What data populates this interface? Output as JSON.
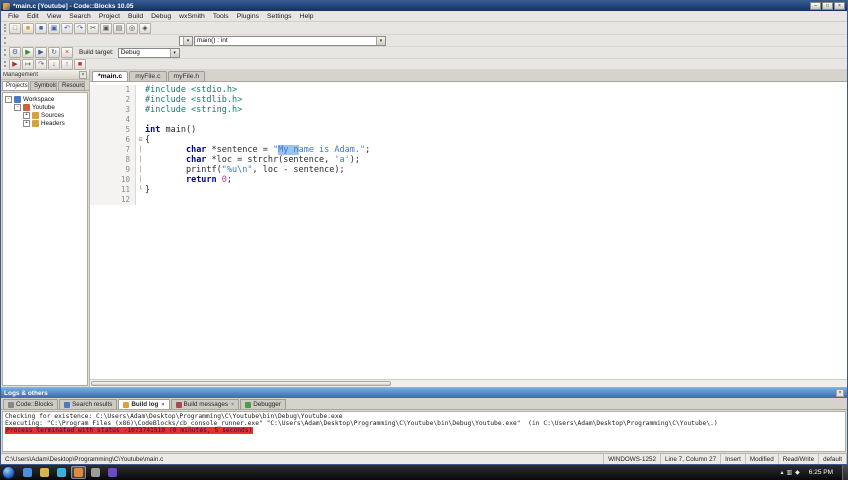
{
  "window": {
    "title": "*main.c [Youtube] - Code::Blocks 10.05",
    "buttons": [
      {
        "name": "minimize-button",
        "glyph": "–"
      },
      {
        "name": "maximize-button",
        "glyph": "□"
      },
      {
        "name": "close-button",
        "glyph": "×"
      }
    ]
  },
  "menu": {
    "items": [
      "File",
      "Edit",
      "View",
      "Search",
      "Project",
      "Build",
      "Debug",
      "wxSmith",
      "Tools",
      "Plugins",
      "Settings",
      "Help"
    ]
  },
  "toolbar": {
    "main_icons": [
      {
        "name": "new-file-icon",
        "glyph": "□",
        "color": "#6a6a6a"
      },
      {
        "name": "open-file-icon",
        "glyph": "■",
        "color": "#d8a23a"
      },
      {
        "name": "save-file-icon",
        "glyph": "■",
        "color": "#3a62b8"
      },
      {
        "name": "save-all-files-icon",
        "glyph": "▣",
        "color": "#3a62b8"
      },
      {
        "name": "undo-icon",
        "glyph": "↶",
        "color": "#2a62c0"
      },
      {
        "name": "redo-icon",
        "glyph": "↷",
        "color": "#2a62c0"
      },
      {
        "name": "cut-icon",
        "glyph": "✂",
        "color": "#555555"
      },
      {
        "name": "copy-icon",
        "glyph": "▣",
        "color": "#555555"
      },
      {
        "name": "paste-icon",
        "glyph": "▤",
        "color": "#555555"
      },
      {
        "name": "find-icon",
        "glyph": "◎",
        "color": "#444444"
      },
      {
        "name": "replace-icon",
        "glyph": "◈",
        "color": "#444444"
      }
    ],
    "symbol_scope_value": "",
    "symbol_function_value": "main() : int",
    "build_icons": [
      {
        "name": "compile-icon",
        "glyph": "⚙",
        "color": "#3a5a9c"
      },
      {
        "name": "run-icon",
        "glyph": "▶",
        "color": "#2e8b2e"
      },
      {
        "name": "build-and-run-icon",
        "glyph": "▶",
        "color": "#3a5a9c"
      },
      {
        "name": "rebuild-icon",
        "glyph": "↻",
        "color": "#3a5a9c"
      },
      {
        "name": "abort-build-icon",
        "glyph": "×",
        "color": "#c03030"
      }
    ],
    "build_target_label": "Build target:",
    "build_target_value": "Debug",
    "debug_icons": [
      {
        "name": "debug-continue-icon",
        "glyph": "▶",
        "color": "#a03030"
      },
      {
        "name": "run-to-cursor-icon",
        "glyph": "↦",
        "color": "#555555"
      },
      {
        "name": "next-line-icon",
        "glyph": "↷",
        "color": "#555555"
      },
      {
        "name": "step-into-icon",
        "glyph": "↓",
        "color": "#555555"
      },
      {
        "name": "step-out-icon",
        "glyph": "↑",
        "color": "#555555"
      },
      {
        "name": "debug-stop-icon",
        "glyph": "■",
        "color": "#c03030"
      }
    ]
  },
  "management": {
    "title": "Management",
    "tabs": [
      {
        "label": "Projects",
        "active": true
      },
      {
        "label": "Symbols",
        "active": false
      },
      {
        "label": "Resources",
        "active": false
      }
    ],
    "tree": [
      {
        "name": "tree-item-workspace",
        "label": "Workspace",
        "depth": 0,
        "expander": "-",
        "icon": "workspace-icon",
        "icon_color": "#4a7ac8"
      },
      {
        "name": "tree-item-youtube",
        "label": "Youtube",
        "depth": 1,
        "expander": "-",
        "icon": "project-icon",
        "icon_color": "#c8643a"
      },
      {
        "name": "tree-item-sources",
        "label": "Sources",
        "depth": 2,
        "expander": "+",
        "icon": "folder-icon",
        "icon_color": "#d8a23a"
      },
      {
        "name": "tree-item-headers",
        "label": "Headers",
        "depth": 2,
        "expander": "+",
        "icon": "folder-icon",
        "icon_color": "#d8a23a"
      }
    ]
  },
  "editor": {
    "tabs": [
      {
        "label": "*main.c",
        "active": true
      },
      {
        "label": "myFile.c",
        "active": false
      },
      {
        "label": "myFile.h",
        "active": false
      }
    ],
    "lines": [
      {
        "num": "1",
        "tokens": [
          {
            "t": "#include <stdio.h>",
            "c": "pre"
          }
        ]
      },
      {
        "num": "2",
        "tokens": [
          {
            "t": "#include <stdlib.h>",
            "c": "pre"
          }
        ]
      },
      {
        "num": "3",
        "tokens": [
          {
            "t": "#include <string.h>",
            "c": "pre"
          }
        ]
      },
      {
        "num": "4",
        "tokens": []
      },
      {
        "num": "5",
        "tokens": [
          {
            "t": "int",
            "c": "kw"
          },
          {
            "t": " main()",
            "c": "pln"
          }
        ]
      },
      {
        "num": "6",
        "fold": "start",
        "tokens": [
          {
            "t": "{",
            "c": "pln"
          }
        ]
      },
      {
        "num": "7",
        "fold": "mid",
        "tokens": [
          {
            "t": "        ",
            "c": "pln"
          },
          {
            "t": "char",
            "c": "kw"
          },
          {
            "t": " *sentence = ",
            "c": "pln"
          },
          {
            "t": "\"",
            "c": "str"
          },
          {
            "t": "My n",
            "c": "str sel"
          },
          {
            "t": "ame is Adam.\"",
            "c": "str"
          },
          {
            "t": ";",
            "c": "pln"
          }
        ]
      },
      {
        "num": "8",
        "fold": "mid",
        "tokens": [
          {
            "t": "        ",
            "c": "pln"
          },
          {
            "t": "char",
            "c": "kw"
          },
          {
            "t": " *loc = strchr(sentence, ",
            "c": "pln"
          },
          {
            "t": "'a'",
            "c": "chr"
          },
          {
            "t": ");",
            "c": "pln"
          }
        ]
      },
      {
        "num": "9",
        "fold": "mid",
        "tokens": [
          {
            "t": "        printf(",
            "c": "pln"
          },
          {
            "t": "\"%u\\n\"",
            "c": "str"
          },
          {
            "t": ", loc - sentence);",
            "c": "pln"
          }
        ]
      },
      {
        "num": "10",
        "fold": "mid",
        "tokens": [
          {
            "t": "        ",
            "c": "pln"
          },
          {
            "t": "return",
            "c": "kw"
          },
          {
            "t": " ",
            "c": "pln"
          },
          {
            "t": "0",
            "c": "num"
          },
          {
            "t": ";",
            "c": "pln"
          }
        ]
      },
      {
        "num": "11",
        "fold": "end",
        "tokens": [
          {
            "t": "}",
            "c": "pln"
          }
        ]
      },
      {
        "num": "12",
        "tokens": []
      }
    ]
  },
  "logs": {
    "caption": "Logs & others",
    "tabs": [
      {
        "name": "logs-tab-codeblocks",
        "label": "Code::Blocks",
        "icon_color": "#888888",
        "active": false,
        "closable": false
      },
      {
        "name": "logs-tab-search-results",
        "label": "Search results",
        "icon_color": "#4a7ac8",
        "active": false,
        "closable": false
      },
      {
        "name": "logs-tab-build-log",
        "label": "Build log",
        "icon_color": "#d8a23a",
        "active": true,
        "closable": true
      },
      {
        "name": "logs-tab-build-messages",
        "label": "Build messages",
        "icon_color": "#b04a4a",
        "active": false,
        "closable": true
      },
      {
        "name": "logs-tab-debugger",
        "label": "Debugger",
        "icon_color": "#4a9c4a",
        "active": false,
        "closable": false
      }
    ],
    "lines": [
      {
        "type": "normal",
        "text": "Checking for existence: C:\\Users\\Adam\\Desktop\\Programming\\C\\Youtube\\bin\\Debug\\Youtube.exe"
      },
      {
        "type": "normal",
        "text": "Executing: \"C:\\Program Files (x86)\\CodeBlocks/cb_console_runner.exe\" \"C:\\Users\\Adam\\Desktop\\Programming\\C\\Youtube\\bin\\Debug\\Youtube.exe\"  (in C:\\Users\\Adam\\Desktop\\Programming\\C\\Youtube\\.)"
      },
      {
        "type": "error",
        "text": "Process terminated with status -1073741510 (0 minutes, 5 seconds)"
      }
    ]
  },
  "statusbar": {
    "fields": [
      {
        "name": "status-file-path",
        "text": "C:\\Users\\Adam\\Desktop\\Programming\\C\\Youtube\\main.c",
        "grow": true
      },
      {
        "name": "status-encoding",
        "text": "WINDOWS-1252",
        "grow": false
      },
      {
        "name": "status-cursor-position",
        "text": "Line 7, Column 27",
        "grow": false
      },
      {
        "name": "status-insert-mode",
        "text": "Insert",
        "grow": false
      },
      {
        "name": "status-modified",
        "text": "Modified",
        "grow": false
      },
      {
        "name": "status-readwrite",
        "text": "Read/Write",
        "grow": false
      },
      {
        "name": "status-profile",
        "text": "default",
        "grow": false
      }
    ]
  },
  "taskbar": {
    "time": "6:25 PM",
    "apps": [
      {
        "name": "taskbar-browser-icon",
        "color": "#4a90d8",
        "active": false
      },
      {
        "name": "taskbar-explorer-icon",
        "color": "#d8b24a",
        "active": false
      },
      {
        "name": "taskbar-media-player-icon",
        "color": "#3ab0d8",
        "active": false
      },
      {
        "name": "taskbar-codeblocks-icon",
        "color": "#e08a3a",
        "active": true
      },
      {
        "name": "taskbar-app5-icon",
        "color": "#9c9c9c",
        "active": false
      },
      {
        "name": "taskbar-app6-icon",
        "color": "#6a4ac8",
        "active": false
      }
    ],
    "tray": [
      {
        "name": "tray-show-hidden-icons",
        "glyph": "▴"
      },
      {
        "name": "tray-network-icon",
        "glyph": "▥"
      },
      {
        "name": "tray-volume-icon",
        "glyph": "◆"
      }
    ]
  },
  "colors": {
    "selection": "#9cc3ef",
    "error_highlight": "#e83030",
    "titlebar": "#1d3c6e",
    "logs_caption": "#3a6ab0"
  }
}
